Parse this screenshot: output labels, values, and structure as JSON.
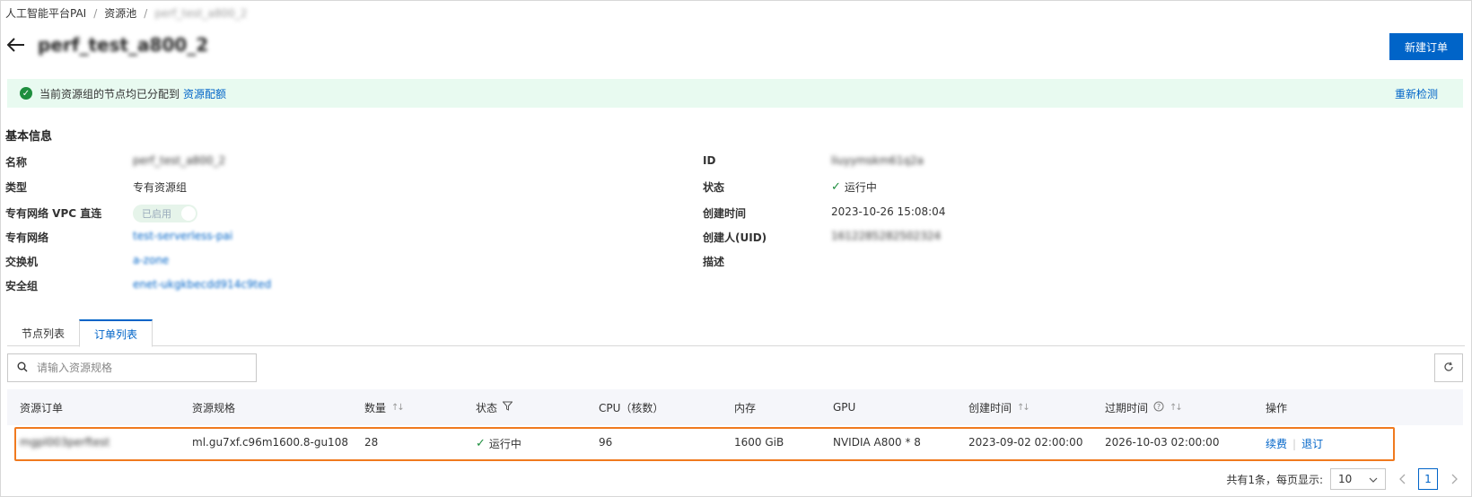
{
  "breadcrumb": {
    "items": [
      "人工智能平台PAI",
      "资源池",
      "perf_test_a800_2"
    ],
    "separator": "/"
  },
  "page": {
    "title": "perf_test_a800_2",
    "new_order_button": "新建订单"
  },
  "notice": {
    "text": "当前资源组的节点均已分配到",
    "link": "资源配额",
    "recheck": "重新检测"
  },
  "basic_info": {
    "section_title": "基本信息",
    "left": [
      {
        "label": "名称",
        "value": "perf_test_a800_2"
      },
      {
        "label": "类型",
        "value": "专有资源组"
      },
      {
        "label": "专有网络 VPC 直连",
        "value": "已启用"
      },
      {
        "label": "专有网络",
        "value": "test-serverless-pai"
      },
      {
        "label": "交换机",
        "value": "a-zone"
      },
      {
        "label": "安全组",
        "value": "enet-ukgkbecdd914c9ted"
      }
    ],
    "right": [
      {
        "label": "ID",
        "value": "liuyymskm61q2a"
      },
      {
        "label": "状态",
        "value": "运行中"
      },
      {
        "label": "创建时间",
        "value": "2023-10-26 15:08:04"
      },
      {
        "label": "创建人(UID)",
        "value": "1612285282502324"
      },
      {
        "label": "描述",
        "value": ""
      }
    ]
  },
  "tabs": [
    "节点列表",
    "订单列表"
  ],
  "active_tab": 1,
  "search": {
    "placeholder": "请输入资源规格"
  },
  "table": {
    "columns": [
      "资源订单",
      "资源规格",
      "数量",
      "状态",
      "CPU（核数）",
      "内存",
      "GPU",
      "创建时间",
      "过期时间",
      "操作"
    ],
    "rows": [
      {
        "order": "mgpl003perftest",
        "spec": "ml.gu7xf.c96m1600.8-gu108",
        "count": "28",
        "status": "运行中",
        "cpu": "96",
        "memory": "1600 GiB",
        "gpu": "NVIDIA A800 * 8",
        "created": "2023-09-02 02:00:00",
        "expires": "2026-10-03 02:00:00",
        "actions": [
          "续费",
          "退订"
        ]
      }
    ]
  },
  "pagination": {
    "summary": "共有1条，每页显示:",
    "page_size": "10",
    "current_page": "1"
  },
  "colors": {
    "primary": "#0064c8",
    "success": "#1e8e3e",
    "highlight": "#f07a1f",
    "notice_bg": "#e8faf0"
  }
}
